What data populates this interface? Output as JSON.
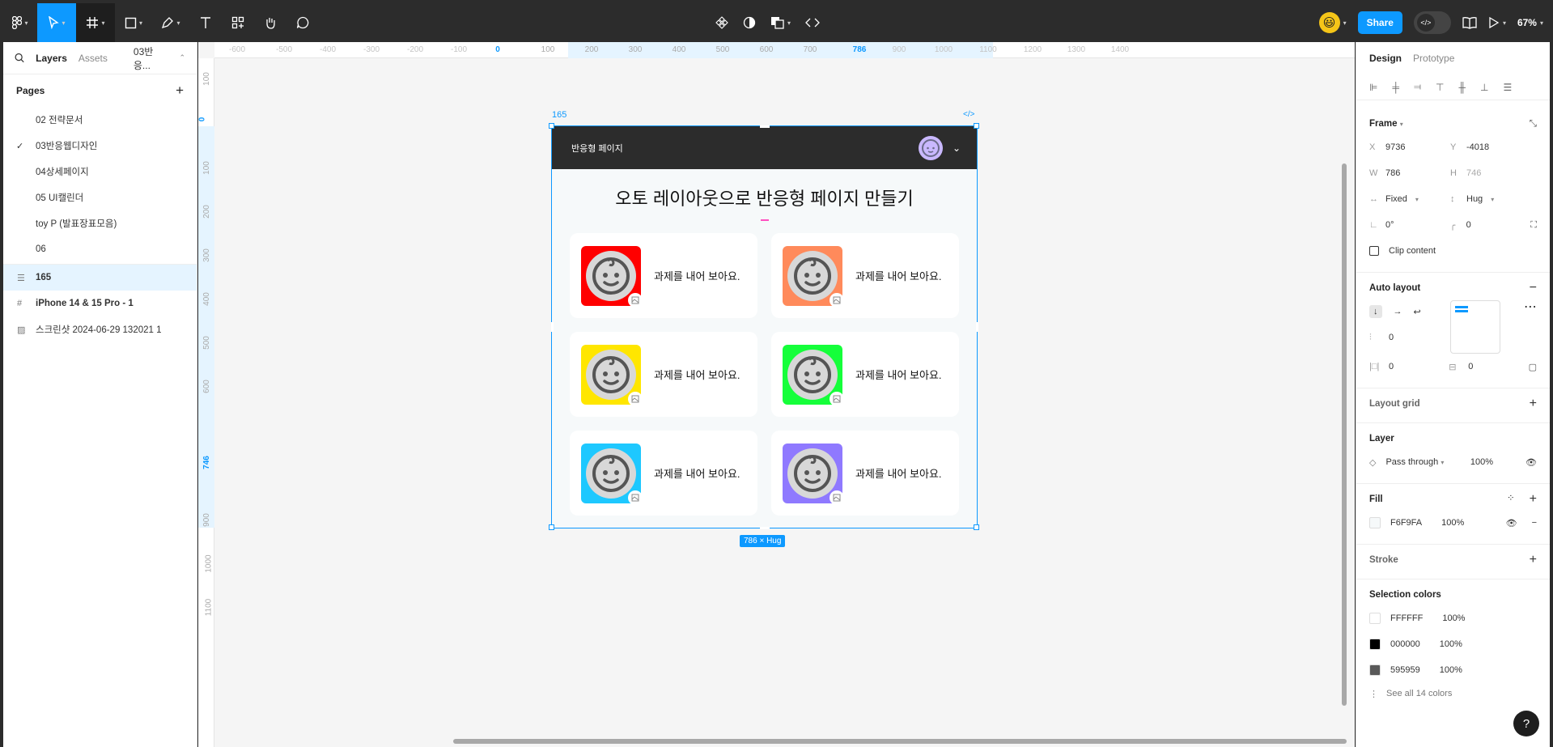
{
  "toolbar": {
    "share_label": "Share",
    "zoom": "67%"
  },
  "left_panel": {
    "tabs": [
      "Layers",
      "Assets"
    ],
    "file_name": "03반응...",
    "pages_title": "Pages",
    "pages": [
      "02 전략문서",
      "03반응웹디자인",
      "04상세페이지",
      "05 UI캘린더",
      "toy P (발표장표모음)",
      "06"
    ],
    "selected_page": "03반응웹디자인",
    "layers": [
      "165",
      "iPhone 14 & 15 Pro - 1",
      "스크린샷 2024-06-29 132021 1"
    ]
  },
  "canvas": {
    "ruler_top": [
      "-600",
      "-500",
      "-400",
      "-300",
      "-200",
      "-100",
      "0",
      "100",
      "200",
      "300",
      "400",
      "500",
      "600",
      "700",
      "786",
      "900",
      "1000",
      "1100",
      "1200",
      "1300",
      "1400"
    ],
    "ruler_left": [
      "100",
      "0",
      "100",
      "200",
      "300",
      "400",
      "500",
      "600",
      "746",
      "900",
      "1000",
      "1100"
    ],
    "frame_name": "165",
    "frame_code": "</>",
    "size_label": "786 × Hug",
    "header_title": "반응형 페이지",
    "heading": "오토 레이아웃으로 반응형 페이지 만들기",
    "cards": [
      {
        "text": "과제를 내어 보아요.",
        "color": "#ff0000"
      },
      {
        "text": "과제를 내어 보아요.",
        "color": "#ff8a5b"
      },
      {
        "text": "과제를 내어 보아요.",
        "color": "#ffe600"
      },
      {
        "text": "과제를 내어 보아요.",
        "color": "#15ff3a"
      },
      {
        "text": "과제를 내어 보아요.",
        "color": "#1ec8ff"
      },
      {
        "text": "과제를 내어 보아요.",
        "color": "#8f79ff"
      }
    ]
  },
  "right_panel": {
    "tabs": [
      "Design",
      "Prototype"
    ],
    "frame_title": "Frame",
    "x_label": "X",
    "x": "9736",
    "y_label": "Y",
    "y": "-4018",
    "w_label": "W",
    "w": "786",
    "h_label": "H",
    "h": "746",
    "width_mode": "Fixed",
    "height_mode": "Hug",
    "rotation": "0°",
    "radius": "0",
    "clip_content": "Clip content",
    "auto_layout_title": "Auto layout",
    "gap": "0",
    "padding_h": "0",
    "padding_v": "0",
    "layout_grid_title": "Layout grid",
    "layer_title": "Layer",
    "blend": "Pass through",
    "layer_opacity": "100%",
    "fill_title": "Fill",
    "fill_hex": "F6F9FA",
    "fill_opacity": "100%",
    "stroke_title": "Stroke",
    "selection_colors_title": "Selection colors",
    "selection_colors": [
      {
        "hex": "FFFFFF",
        "pct": "100%",
        "color": "#ffffff"
      },
      {
        "hex": "000000",
        "pct": "100%",
        "color": "#000000"
      },
      {
        "hex": "595959",
        "pct": "100%",
        "color": "#595959"
      }
    ],
    "see_all": "See all 14 colors",
    "help": "?"
  }
}
